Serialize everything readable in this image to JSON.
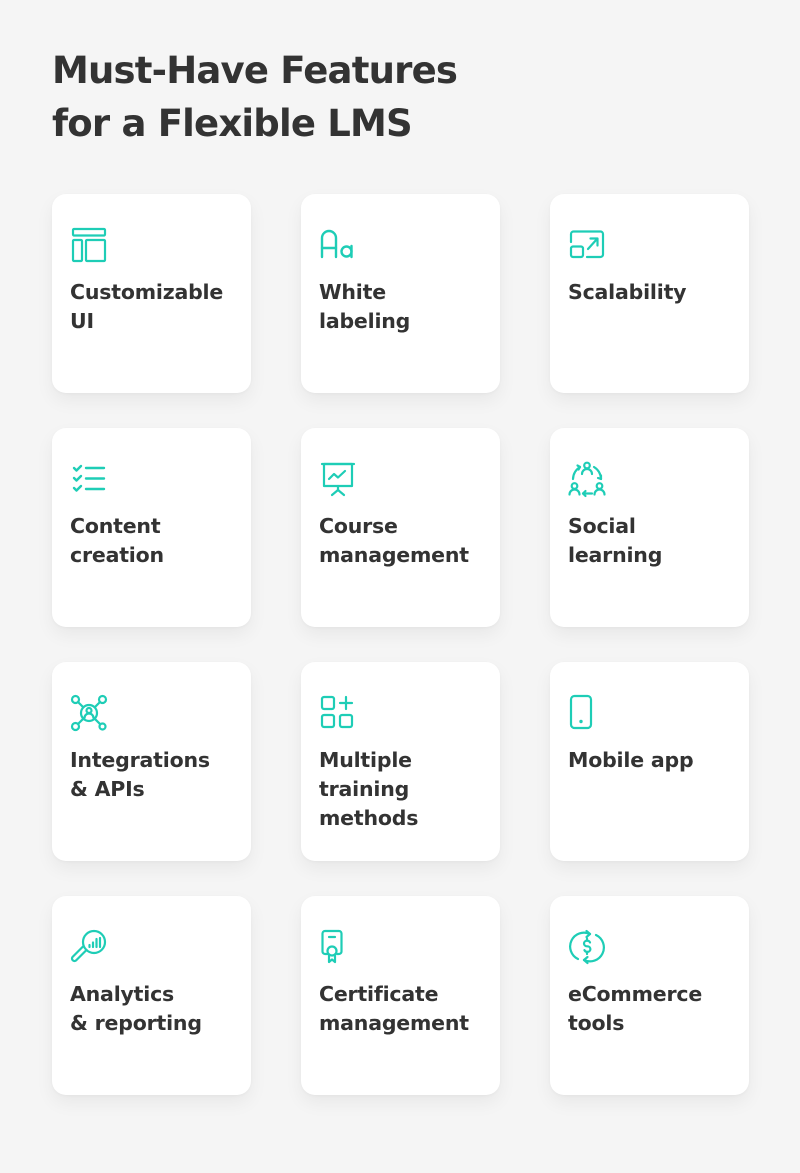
{
  "header": {
    "title_line1": "Must-Have Features",
    "title_line2": "for a Flexible LMS"
  },
  "colors": {
    "background": "#f5f5f5",
    "card": "#ffffff",
    "accent": "#1ecdb6",
    "text": "#333333"
  },
  "features": [
    {
      "label": "Customizable\nUI",
      "icon": "layout-icon"
    },
    {
      "label": "White\nlabeling",
      "icon": "typography-icon"
    },
    {
      "label": "Scalability",
      "icon": "resize-screen-icon"
    },
    {
      "label": "Content\ncreation",
      "icon": "checklist-icon"
    },
    {
      "label": "Course\nmanagement",
      "icon": "presentation-board-icon"
    },
    {
      "label": "Social\nlearning",
      "icon": "people-cycle-icon"
    },
    {
      "label": "Integrations\n& APIs",
      "icon": "network-hub-icon"
    },
    {
      "label": "Multiple\ntraining\nmethods",
      "icon": "add-modules-icon"
    },
    {
      "label": "Mobile app",
      "icon": "smartphone-icon"
    },
    {
      "label": "Analytics\n& reporting",
      "icon": "magnifier-chart-icon"
    },
    {
      "label": "Certificate\nmanagement",
      "icon": "certificate-icon"
    },
    {
      "label": "eCommerce\ntools",
      "icon": "currency-exchange-icon"
    }
  ]
}
